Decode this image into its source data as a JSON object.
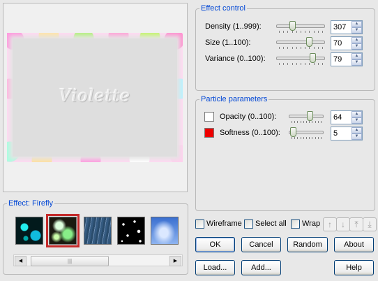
{
  "preview": {
    "watermark": "Violette"
  },
  "effect_control": {
    "title": "Effect control",
    "params": [
      {
        "label": "Density (1..999):",
        "value": "307",
        "fraction": 0.31
      },
      {
        "label": "Size (1..100):",
        "value": "70",
        "fraction": 0.7
      },
      {
        "label": "Variance (0..100):",
        "value": "79",
        "fraction": 0.79
      }
    ]
  },
  "particle_parameters": {
    "title": "Particle parameters",
    "params": [
      {
        "label": "Opacity (0..100):",
        "value": "64",
        "fraction": 0.64,
        "color": "#ffffff"
      },
      {
        "label": "Softness (0..100):",
        "value": "5",
        "fraction": 0.05,
        "color": "#ee0000"
      }
    ]
  },
  "effect_panel": {
    "title": "Effect: Firefly",
    "thumbnails": [
      {
        "name": "bubbles-thumbnail"
      },
      {
        "name": "firefly-thumbnail",
        "selected": true
      },
      {
        "name": "rain-thumbnail"
      },
      {
        "name": "stars-thumbnail"
      },
      {
        "name": "clouds-thumbnail"
      }
    ],
    "scroll_grip": "|||"
  },
  "options": {
    "wireframe": "Wireframe",
    "select_all": "Select all",
    "wrap": "Wrap"
  },
  "arrow_buttons": [
    "↑",
    "↓",
    "⤒",
    "⤓"
  ],
  "buttons": {
    "ok": "OK",
    "cancel": "Cancel",
    "random": "Random",
    "about": "About",
    "load": "Load...",
    "add": "Add...",
    "help": "Help"
  },
  "spin_arrows": {
    "up": "▲",
    "down": "▼"
  },
  "scroll_arrows": {
    "left": "◀",
    "right": "▶"
  }
}
